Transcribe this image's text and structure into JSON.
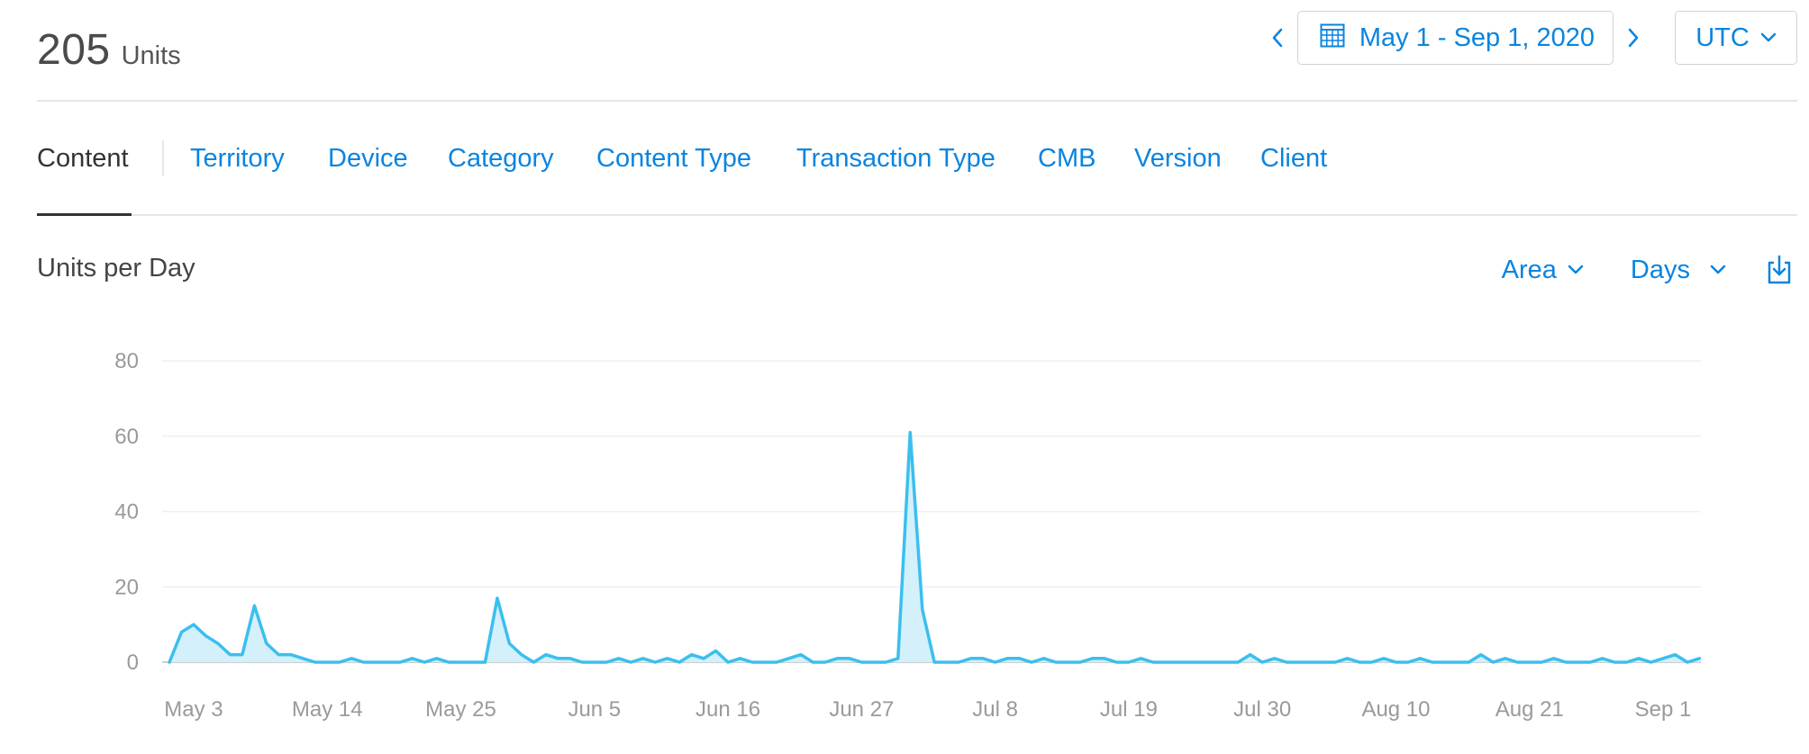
{
  "header": {
    "total_value": "205",
    "total_unit": "Units",
    "date_range": "May 1 - Sep 1, 2020",
    "timezone": "UTC"
  },
  "tabs": [
    {
      "label": "Content",
      "active": true
    },
    {
      "label": "Territory",
      "active": false
    },
    {
      "label": "Device",
      "active": false
    },
    {
      "label": "Category",
      "active": false
    },
    {
      "label": "Content Type",
      "active": false
    },
    {
      "label": "Transaction Type",
      "active": false
    },
    {
      "label": "CMB",
      "active": false
    },
    {
      "label": "Version",
      "active": false
    },
    {
      "label": "Client",
      "active": false
    }
  ],
  "chart_panel": {
    "title": "Units per Day",
    "chart_type_label": "Area",
    "granularity_label": "Days",
    "icons": [
      "chevron-left-icon",
      "calendar-icon",
      "chevron-right-icon",
      "chevron-down-icon",
      "download-icon"
    ]
  },
  "colors": {
    "accent": "#0a84e0",
    "series_line": "#3bbfee",
    "series_fill": "#d3f0fb"
  },
  "chart_data": {
    "type": "area",
    "title": "",
    "xlabel": "",
    "ylabel": "",
    "ylim": [
      0,
      80
    ],
    "yticks": [
      0,
      20,
      40,
      60,
      80
    ],
    "grid": true,
    "x_tick_labels": [
      "May 3",
      "May 14",
      "May 25",
      "Jun 5",
      "Jun 16",
      "Jun 27",
      "Jul 8",
      "Jul 19",
      "Jul 30",
      "Aug 10",
      "Aug 21",
      "Sep 1"
    ],
    "x_start": "May 1",
    "series": [
      {
        "values": [
          0,
          8,
          10,
          7,
          5,
          2,
          2,
          15,
          5,
          2,
          2,
          1,
          0,
          0,
          0,
          1,
          0,
          0,
          0,
          0,
          1,
          0,
          1,
          0,
          0,
          0,
          0,
          17,
          5,
          2,
          0,
          2,
          1,
          1,
          0,
          0,
          0,
          1,
          0,
          1,
          0,
          1,
          0,
          2,
          1,
          3,
          0,
          1,
          0,
          0,
          0,
          1,
          2,
          0,
          0,
          1,
          1,
          0,
          0,
          0,
          1,
          61,
          14,
          0,
          0,
          0,
          1,
          1,
          0,
          1,
          1,
          0,
          1,
          0,
          0,
          0,
          1,
          1,
          0,
          0,
          1,
          0,
          0,
          0,
          0,
          0,
          0,
          0,
          0,
          2,
          0,
          1,
          0,
          0,
          0,
          0,
          0,
          1,
          0,
          0,
          1,
          0,
          0,
          1,
          0,
          0,
          0,
          0,
          2,
          0,
          1,
          0,
          0,
          0,
          1,
          0,
          0,
          0,
          1,
          0,
          0,
          1,
          0,
          1,
          2,
          0,
          1
        ]
      }
    ]
  }
}
